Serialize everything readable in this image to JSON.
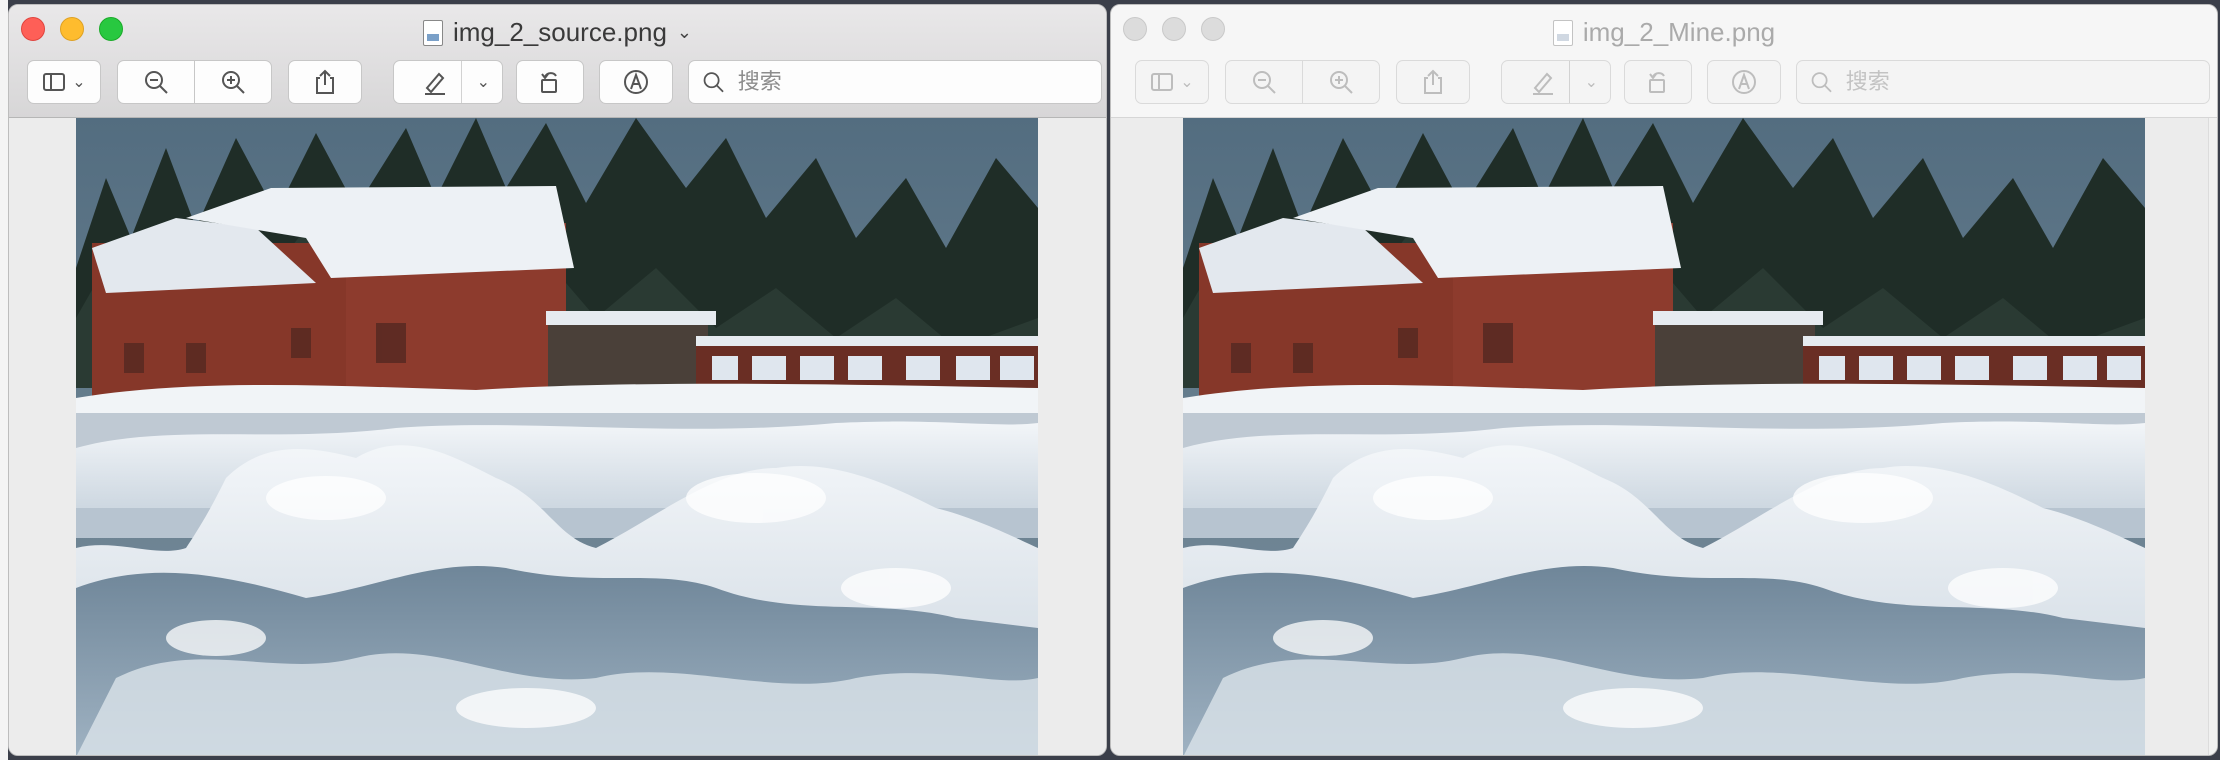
{
  "windows": [
    {
      "title": "img_2_source.png",
      "active": true,
      "search_placeholder": "搜索",
      "icons": [
        "sidebar-icon",
        "zoom-out-icon",
        "zoom-in-icon",
        "share-icon",
        "markup-pen-icon",
        "rotate-icon",
        "annotate-icon",
        "search-icon"
      ]
    },
    {
      "title": "img_2_Mine.png",
      "active": false,
      "search_placeholder": "搜索",
      "icons": [
        "sidebar-icon",
        "zoom-out-icon",
        "zoom-in-icon",
        "share-icon",
        "markup-pen-icon",
        "rotate-icon",
        "annotate-icon",
        "search-icon"
      ]
    }
  ],
  "colors": {
    "close": "#fe5f57",
    "minimize": "#febc2e",
    "maximize": "#28c840",
    "sky": "#4f6a7d",
    "trees": "#1e2c25",
    "barn": "#8a3a2c",
    "roof_snow": "#e9edf2",
    "snow_shadow": "#8fa3b5"
  }
}
